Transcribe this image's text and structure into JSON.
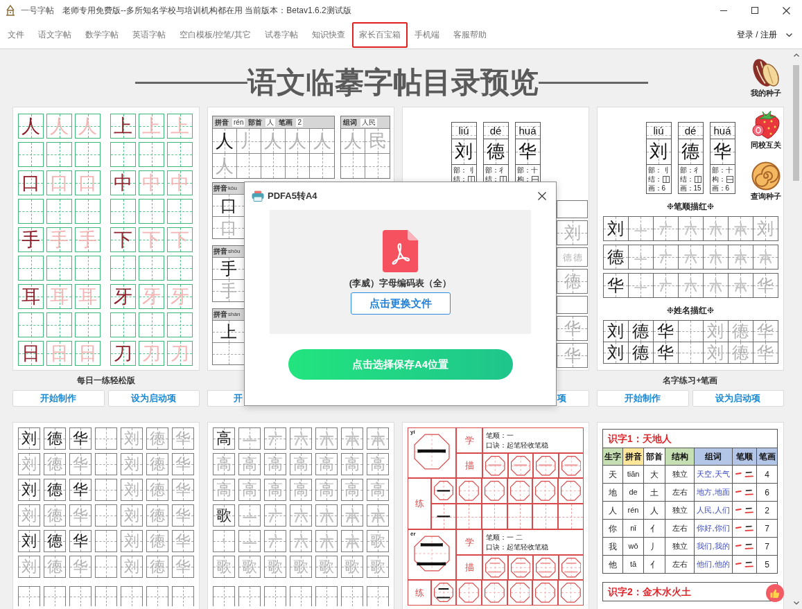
{
  "window": {
    "app_name": "一号字帖",
    "title": "老师专用免费版--多所知名学校与培训机构都在用 当前版本：Betav1.6.2测试版"
  },
  "menu": [
    {
      "label": "文件",
      "highlighted": false
    },
    {
      "label": "语文字帖",
      "highlighted": false
    },
    {
      "label": "数学字帖",
      "highlighted": false
    },
    {
      "label": "英语字帖",
      "highlighted": false
    },
    {
      "label": "空白模板/控笔/其它",
      "highlighted": false
    },
    {
      "label": "试卷字帖",
      "highlighted": false
    },
    {
      "label": "知识快查",
      "highlighted": false
    },
    {
      "label": "家长百宝箱",
      "highlighted": true
    },
    {
      "label": "手机端",
      "highlighted": false
    },
    {
      "label": "客服帮助",
      "highlighted": false
    }
  ],
  "account": {
    "label": "登录 / 注册"
  },
  "heading": "语文临摹字帖目录预览",
  "side_shortcuts": [
    {
      "kind": "seed",
      "label": "我的种子"
    },
    {
      "kind": "strawberry",
      "label": "同校互关"
    },
    {
      "kind": "bun",
      "label": "查询种子"
    }
  ],
  "templates": [
    {
      "kind": "green_grid",
      "caption": "每日一练轻松版",
      "buttons": [
        {
          "kind": "start",
          "label": "开始制作",
          "clipped": false
        },
        {
          "kind": "startup",
          "label": "设为启动项",
          "clipped": false
        }
      ],
      "rows": [
        {
          "kind": "chars",
          "cells": [
            {
              "kind": "char",
              "text": "人",
              "faded": false
            },
            {
              "kind": "char",
              "text": "人",
              "faded": true
            },
            {
              "kind": "char",
              "text": "人",
              "faded": true
            },
            {
              "kind": "char",
              "text": "上",
              "faded": false
            },
            {
              "kind": "char",
              "text": "上",
              "faded": true
            },
            {
              "kind": "char",
              "text": "上",
              "faded": true
            }
          ]
        },
        {
          "kind": "blank"
        },
        {
          "kind": "chars",
          "cells": [
            {
              "kind": "char",
              "text": "口",
              "faded": false
            },
            {
              "kind": "char",
              "text": "口",
              "faded": true
            },
            {
              "kind": "char",
              "text": "口",
              "faded": true
            },
            {
              "kind": "char",
              "text": "中",
              "faded": false
            },
            {
              "kind": "char",
              "text": "中",
              "faded": true
            },
            {
              "kind": "char",
              "text": "中",
              "faded": true
            }
          ]
        },
        {
          "kind": "blank"
        },
        {
          "kind": "chars",
          "cells": [
            {
              "kind": "char",
              "text": "手",
              "faded": false
            },
            {
              "kind": "char",
              "text": "手",
              "faded": true
            },
            {
              "kind": "char",
              "text": "手",
              "faded": true
            },
            {
              "kind": "char",
              "text": "下",
              "faded": false
            },
            {
              "kind": "char",
              "text": "下",
              "faded": true
            },
            {
              "kind": "char",
              "text": "下",
              "faded": true
            }
          ]
        },
        {
          "kind": "blank"
        },
        {
          "kind": "chars",
          "cells": [
            {
              "kind": "char",
              "text": "耳",
              "faded": false
            },
            {
              "kind": "char",
              "text": "耳",
              "faded": true
            },
            {
              "kind": "char",
              "text": "耳",
              "faded": true
            },
            {
              "kind": "char",
              "text": "牙",
              "faded": false
            },
            {
              "kind": "char",
              "text": "牙",
              "faded": true
            },
            {
              "kind": "char",
              "text": "牙",
              "faded": true
            }
          ]
        },
        {
          "kind": "blank"
        },
        {
          "kind": "chars",
          "cells": [
            {
              "kind": "char",
              "text": "日",
              "faded": false
            },
            {
              "kind": "char",
              "text": "日",
              "faded": true
            },
            {
              "kind": "char",
              "text": "日",
              "faded": true
            },
            {
              "kind": "char",
              "text": "刀",
              "faded": false
            },
            {
              "kind": "char",
              "text": "刀",
              "faded": true
            },
            {
              "kind": "char",
              "text": "刀",
              "faded": true
            }
          ]
        }
      ]
    },
    {
      "kind": "pinyin_sheet",
      "buttons": [
        {
          "kind": "start",
          "label": "开",
          "clipped": true
        }
      ],
      "main_table": {
        "header": [
          {
            "kind": "label",
            "text": "拼音"
          },
          {
            "kind": "value",
            "text": "rén"
          },
          {
            "kind": "label",
            "text": "部首"
          },
          {
            "kind": "value",
            "text": "人"
          },
          {
            "kind": "label",
            "text": "笔画"
          },
          {
            "kind": "value",
            "text": "2"
          }
        ],
        "rows": [
          [
            {
              "kind": "char",
              "text": "人",
              "faded": false
            },
            {
              "kind": "char",
              "text": "丿",
              "faded": true
            },
            {
              "kind": "char",
              "text": "人",
              "faded": true
            },
            {
              "kind": "char",
              "text": "人",
              "faded": true
            },
            {
              "kind": "char",
              "text": "人",
              "faded": true
            }
          ],
          [
            {
              "kind": "char",
              "text": "人",
              "faded": true
            },
            {
              "kind": "empty"
            },
            {
              "kind": "empty"
            },
            {
              "kind": "empty"
            },
            {
              "kind": "empty"
            }
          ]
        ]
      },
      "word_table": {
        "header": [
          {
            "kind": "label",
            "text": "组词"
          },
          {
            "kind": "value",
            "text": "人民"
          }
        ],
        "rows": [
          [
            {
              "kind": "char",
              "text": "人",
              "faded": true
            },
            {
              "kind": "char",
              "text": "民",
              "faded": true
            }
          ],
          [
            {
              "kind": "empty"
            },
            {
              "kind": "empty"
            }
          ]
        ]
      },
      "strip_tables": [
        {
          "header": [
            {
              "kind": "label",
              "text": "拼音"
            },
            {
              "kind": "value",
              "text": "kǒu"
            }
          ],
          "rows": [
            [
              {
                "kind": "char",
                "text": "口",
                "faded": false
              }
            ],
            [
              {
                "kind": "char",
                "text": "口",
                "faded": true
              }
            ]
          ]
        },
        {
          "header": [
            {
              "kind": "label",
              "text": "拼音"
            },
            {
              "kind": "value",
              "text": "shǒu"
            }
          ],
          "rows": [
            [
              {
                "kind": "char",
                "text": "手",
                "faded": false
              }
            ],
            [
              {
                "kind": "char",
                "text": "手",
                "faded": true
              }
            ]
          ]
        },
        {
          "header": [
            {
              "kind": "label",
              "text": "拼音"
            },
            {
              "kind": "value",
              "text": "shàn"
            }
          ],
          "rows": [
            [
              {
                "kind": "char",
                "text": "上",
                "faded": false
              }
            ],
            [
              {
                "kind": "empty"
              }
            ]
          ]
        }
      ]
    },
    {
      "kind": "name_strip",
      "buttons": [
        {
          "kind": "startup",
          "label": "项",
          "clipped": true
        }
      ],
      "pinyin_cards": [
        {
          "pinyin": "liú",
          "char": "刘",
          "info": [
            {
              "kind": "text",
              "text": "部：刂"
            },
            {
              "kind": "leftright",
              "label": "结："
            }
          ]
        },
        {
          "pinyin": "dé",
          "char": "德",
          "info": [
            {
              "kind": "text",
              "text": "部：彳"
            },
            {
              "kind": "leftright",
              "label": "结："
            }
          ]
        },
        {
          "pinyin": "huá",
          "char": "华",
          "info": [
            {
              "kind": "text",
              "text": "部：十"
            },
            {
              "kind": "topbottom",
              "label": "构："
            }
          ]
        }
      ],
      "strip": [
        {
          "kind": "blank"
        },
        {
          "kind": "char",
          "text": "刘",
          "faded": true
        },
        {
          "kind": "mini",
          "texts": [
            "德",
            "德"
          ]
        },
        {
          "kind": "char",
          "text": "德",
          "faded": true
        },
        {
          "kind": "blank"
        },
        {
          "kind": "char",
          "text": "华",
          "faded": true
        },
        {
          "kind": "char",
          "text": "华",
          "faded": true
        }
      ]
    },
    {
      "kind": "name_strokes",
      "caption": "名字练习+笔画",
      "buttons": [
        {
          "kind": "start",
          "label": "开始制作",
          "clipped": false
        },
        {
          "kind": "startup",
          "label": "设为启动项",
          "clipped": false
        }
      ],
      "pinyin_cards": [
        {
          "pinyin": "liú",
          "char": "刘",
          "info": [
            {
              "kind": "text",
              "text": "部：刂"
            },
            {
              "kind": "leftright",
              "label": "结："
            },
            {
              "kind": "text",
              "text": "画：6"
            }
          ]
        },
        {
          "pinyin": "dé",
          "char": "德",
          "info": [
            {
              "kind": "text",
              "text": "部：彳"
            },
            {
              "kind": "leftright",
              "label": "结："
            },
            {
              "kind": "text",
              "text": "画：15"
            }
          ]
        },
        {
          "pinyin": "huá",
          "char": "华",
          "info": [
            {
              "kind": "text",
              "text": "部：十"
            },
            {
              "kind": "topbottom",
              "label": "构："
            },
            {
              "kind": "text",
              "text": "画：6"
            }
          ]
        }
      ],
      "sections": [
        {
          "title": "❉笔顺描红❉",
          "rows": [
            [
              {
                "kind": "char",
                "text": "刘",
                "faded": false
              },
              {
                "kind": "stroke"
              },
              {
                "kind": "stroke"
              },
              {
                "kind": "stroke"
              },
              {
                "kind": "stroke"
              },
              {
                "kind": "stroke"
              },
              {
                "kind": "char",
                "text": "刘",
                "faded": true
              }
            ],
            [
              {
                "kind": "char",
                "text": "德",
                "faded": false
              },
              {
                "kind": "stroke"
              },
              {
                "kind": "stroke"
              },
              {
                "kind": "stroke"
              },
              {
                "kind": "stroke"
              },
              {
                "kind": "stroke"
              },
              {
                "kind": "stroke"
              }
            ],
            [
              {
                "kind": "char",
                "text": "华",
                "faded": false
              },
              {
                "kind": "stroke"
              },
              {
                "kind": "stroke"
              },
              {
                "kind": "stroke"
              },
              {
                "kind": "stroke"
              },
              {
                "kind": "stroke"
              },
              {
                "kind": "char",
                "text": "华",
                "faded": true
              }
            ]
          ]
        },
        {
          "title": "❉姓名描红❉",
          "rows": [
            [
              {
                "kind": "char",
                "text": "刘",
                "faded": false
              },
              {
                "kind": "char",
                "text": "德",
                "faded": false
              },
              {
                "kind": "char",
                "text": "华",
                "faded": false
              },
              {
                "kind": "empty"
              },
              {
                "kind": "char",
                "text": "刘",
                "faded": true
              },
              {
                "kind": "char",
                "text": "德",
                "faded": true
              },
              {
                "kind": "char",
                "text": "华",
                "faded": true
              }
            ],
            [
              {
                "kind": "char",
                "text": "刘",
                "faded": false
              },
              {
                "kind": "char",
                "text": "德",
                "faded": false
              },
              {
                "kind": "char",
                "text": "华",
                "faded": false
              },
              {
                "kind": "empty"
              },
              {
                "kind": "char",
                "text": "刘",
                "faded": true
              },
              {
                "kind": "char",
                "text": "德",
                "faded": true
              },
              {
                "kind": "char",
                "text": "华",
                "faded": true
              }
            ]
          ]
        }
      ]
    },
    {
      "kind": "gray_grid",
      "rows": [
        {
          "kind": "cells",
          "cells": [
            {
              "kind": "char",
              "text": "刘",
              "faded": false
            },
            {
              "kind": "char",
              "text": "德",
              "faded": false
            },
            {
              "kind": "char",
              "text": "华",
              "faded": false
            },
            {
              "kind": "empty"
            },
            {
              "kind": "char",
              "text": "刘",
              "faded": true
            },
            {
              "kind": "char",
              "text": "德",
              "faded": true
            },
            {
              "kind": "char",
              "text": "华",
              "faded": true
            }
          ]
        },
        {
          "kind": "cells",
          "cells": [
            {
              "kind": "char",
              "text": "刘",
              "faded": true
            },
            {
              "kind": "char",
              "text": "德",
              "faded": true
            },
            {
              "kind": "char",
              "text": "华",
              "faded": true
            },
            {
              "kind": "empty"
            },
            {
              "kind": "char",
              "text": "刘",
              "faded": true
            },
            {
              "kind": "char",
              "text": "德",
              "faded": true
            },
            {
              "kind": "char",
              "text": "华",
              "faded": true
            }
          ]
        },
        {
          "kind": "cells",
          "cells": [
            {
              "kind": "char",
              "text": "刘",
              "faded": false
            },
            {
              "kind": "char",
              "text": "德",
              "faded": false
            },
            {
              "kind": "char",
              "text": "华",
              "faded": false
            },
            {
              "kind": "empty"
            },
            {
              "kind": "char",
              "text": "刘",
              "faded": true
            },
            {
              "kind": "char",
              "text": "德",
              "faded": true
            },
            {
              "kind": "char",
              "text": "华",
              "faded": true
            }
          ]
        },
        {
          "kind": "cells",
          "cells": [
            {
              "kind": "char",
              "text": "刘",
              "faded": true
            },
            {
              "kind": "char",
              "text": "德",
              "faded": true
            },
            {
              "kind": "char",
              "text": "华",
              "faded": true
            },
            {
              "kind": "empty"
            },
            {
              "kind": "char",
              "text": "刘",
              "faded": true
            },
            {
              "kind": "char",
              "text": "德",
              "faded": true
            },
            {
              "kind": "char",
              "text": "华",
              "faded": true
            }
          ]
        },
        {
          "kind": "cells",
          "cells": [
            {
              "kind": "char",
              "text": "刘",
              "faded": false
            },
            {
              "kind": "char",
              "text": "德",
              "faded": false
            },
            {
              "kind": "char",
              "text": "华",
              "faded": false
            },
            {
              "kind": "empty"
            },
            {
              "kind": "char",
              "text": "刘",
              "faded": true
            },
            {
              "kind": "char",
              "text": "德",
              "faded": true
            },
            {
              "kind": "char",
              "text": "华",
              "faded": true
            }
          ]
        },
        {
          "kind": "cells",
          "cells": [
            {
              "kind": "char",
              "text": "刘",
              "faded": true
            },
            {
              "kind": "char",
              "text": "德",
              "faded": true
            },
            {
              "kind": "char",
              "text": "华",
              "faded": true
            },
            {
              "kind": "empty"
            },
            {
              "kind": "char",
              "text": "刘",
              "faded": true
            },
            {
              "kind": "char",
              "text": "德",
              "faded": true
            },
            {
              "kind": "char",
              "text": "华",
              "faded": true
            }
          ]
        },
        {
          "kind": "cut_off"
        }
      ]
    },
    {
      "kind": "gray_grid",
      "rows": [
        {
          "kind": "cells",
          "cells": [
            {
              "kind": "char",
              "text": "高",
              "faded": false
            },
            {
              "kind": "stroke"
            },
            {
              "kind": "stroke"
            },
            {
              "kind": "stroke"
            },
            {
              "kind": "stroke"
            },
            {
              "kind": "stroke"
            },
            {
              "kind": "stroke"
            }
          ]
        },
        {
          "kind": "cells",
          "cells": [
            {
              "kind": "char",
              "text": "高",
              "faded": true
            },
            {
              "kind": "char",
              "text": "高",
              "faded": true
            },
            {
              "kind": "char",
              "text": "高",
              "faded": true
            },
            {
              "kind": "char",
              "text": "高",
              "faded": true
            },
            {
              "kind": "char",
              "text": "高",
              "faded": true
            },
            {
              "kind": "char",
              "text": "高",
              "faded": true
            },
            {
              "kind": "char",
              "text": "高",
              "faded": true
            }
          ]
        },
        {
          "kind": "cells",
          "cells": [
            {
              "kind": "char",
              "text": "高",
              "faded": true
            },
            {
              "kind": "char",
              "text": "高",
              "faded": true
            },
            {
              "kind": "char",
              "text": "高",
              "faded": true
            },
            {
              "kind": "char",
              "text": "高",
              "faded": true
            },
            {
              "kind": "char",
              "text": "高",
              "faded": true
            },
            {
              "kind": "char",
              "text": "高",
              "faded": true
            },
            {
              "kind": "char",
              "text": "高",
              "faded": true
            }
          ]
        },
        {
          "kind": "cells",
          "cells": [
            {
              "kind": "char",
              "text": "歌",
              "faded": false
            },
            {
              "kind": "stroke"
            },
            {
              "kind": "stroke"
            },
            {
              "kind": "stroke"
            },
            {
              "kind": "stroke"
            },
            {
              "kind": "stroke"
            },
            {
              "kind": "stroke"
            }
          ]
        },
        {
          "kind": "cells",
          "cells": [
            {
              "kind": "stroke"
            },
            {
              "kind": "stroke"
            },
            {
              "kind": "stroke"
            },
            {
              "kind": "stroke"
            },
            {
              "kind": "stroke"
            },
            {
              "kind": "stroke"
            },
            {
              "kind": "char",
              "text": "歌",
              "faded": true
            }
          ]
        },
        {
          "kind": "cells",
          "cells": [
            {
              "kind": "char",
              "text": "歌",
              "faded": true
            },
            {
              "kind": "char",
              "text": "歌",
              "faded": true
            },
            {
              "kind": "char",
              "text": "歌",
              "faded": true
            },
            {
              "kind": "char",
              "text": "歌",
              "faded": true
            },
            {
              "kind": "char",
              "text": "歌",
              "faded": true
            },
            {
              "kind": "char",
              "text": "歌",
              "faded": true
            },
            {
              "kind": "char",
              "text": "歌",
              "faded": true
            }
          ]
        },
        {
          "kind": "cut_off"
        }
      ]
    },
    {
      "kind": "octagon_sheet",
      "blocks": [
        {
          "pinyin": "yi",
          "char": "一",
          "study_label": "学",
          "trace_label": "描",
          "stroke_order": "笔顺：一",
          "mnemonic": "口诀：起笔轻收笔稳",
          "trace_cells": [
            {
              "kind": "octagon",
              "text": "一",
              "faded": true
            },
            {
              "kind": "octagon",
              "text": "一",
              "faded": true
            },
            {
              "kind": "octagon",
              "text": "一",
              "faded": true
            },
            {
              "kind": "octagon",
              "text": "一",
              "faded": true
            }
          ],
          "practice_label": "练",
          "practice_rows": [
            {
              "lead": {
                "kind": "octagon",
                "text": "一",
                "faded": false
              },
              "cells": [
                {
                  "kind": "octagon"
                },
                {
                  "kind": "octagon"
                },
                {
                  "kind": "octagon"
                },
                {
                  "kind": "octagon"
                },
                {
                  "kind": "octagon"
                }
              ]
            },
            {
              "lead": {
                "kind": "plain",
                "text": "一",
                "faded": false
              },
              "cells": [
                {
                  "kind": "plain"
                },
                {
                  "kind": "plain"
                },
                {
                  "kind": "plain"
                },
                {
                  "kind": "plain"
                },
                {
                  "kind": "plain"
                }
              ]
            }
          ]
        },
        {
          "pinyin": "èr",
          "char": "二",
          "study_label": "学",
          "trace_label": "描",
          "stroke_order": "笔顺：一 二",
          "mnemonic": "口诀：起笔轻收笔稳",
          "trace_cells": [
            {
              "kind": "octagon",
              "text": "二",
              "faded": true
            },
            {
              "kind": "octagon",
              "text": "二",
              "faded": true
            },
            {
              "kind": "octagon",
              "text": "二",
              "faded": true
            },
            {
              "kind": "octagon",
              "text": "二",
              "faded": true
            }
          ],
          "practice_label": "练",
          "practice_rows": [
            {
              "lead": {
                "kind": "octagon",
                "text": "二",
                "faded": false
              },
              "cells": [
                {
                  "kind": "octagon"
                },
                {
                  "kind": "octagon"
                },
                {
                  "kind": "octagon"
                },
                {
                  "kind": "octagon"
                },
                {
                  "kind": "octagon"
                }
              ]
            }
          ]
        }
      ]
    },
    {
      "kind": "literacy_table",
      "tables": [
        {
          "title": "识字1：天地人",
          "columns": [
            {
              "label": "生字",
              "color": "#c6e0b4"
            },
            {
              "label": "拼音",
              "color": "#ffe699"
            },
            {
              "label": "部首",
              "color": "#ffffff"
            },
            {
              "label": "结构",
              "color": "#c6e0b4"
            },
            {
              "label": "组词",
              "color": "#b4c6e7"
            },
            {
              "label": "笔顺",
              "color": "#b4c6e7"
            },
            {
              "label": "笔画",
              "color": "#b4c6e7"
            }
          ],
          "rows": [
            {
              "char": "天",
              "pinyin": "tiān",
              "radical": "大",
              "structure": "独立",
              "words": "天空,天气",
              "strokes": "4"
            },
            {
              "char": "地",
              "pinyin": "de",
              "radical": "土",
              "structure": "左右",
              "words": "地方,地面",
              "strokes": "6"
            },
            {
              "char": "人",
              "pinyin": "rén",
              "radical": "人",
              "structure": "独立",
              "words": "人民,人们",
              "strokes": "2"
            },
            {
              "char": "你",
              "pinyin": "nǐ",
              "radical": "亻",
              "structure": "左右",
              "words": "你好,你们",
              "strokes": "7"
            },
            {
              "char": "我",
              "pinyin": "wǒ",
              "radical": "丿",
              "structure": "独立",
              "words": "我们,我的",
              "strokes": "7"
            },
            {
              "char": "他",
              "pinyin": "tā",
              "radical": "亻",
              "structure": "左右",
              "words": "他们,他的",
              "strokes": "5"
            }
          ]
        },
        {
          "title": "识字2：金木水火土"
        }
      ]
    }
  ],
  "dialog": {
    "title": "PDFA5转A4",
    "file_name": "(李威）字母编码表（全）",
    "change_button": {
      "label": "点击更换文件"
    },
    "save_button": {
      "label": "点击选择保存A4位置"
    }
  }
}
